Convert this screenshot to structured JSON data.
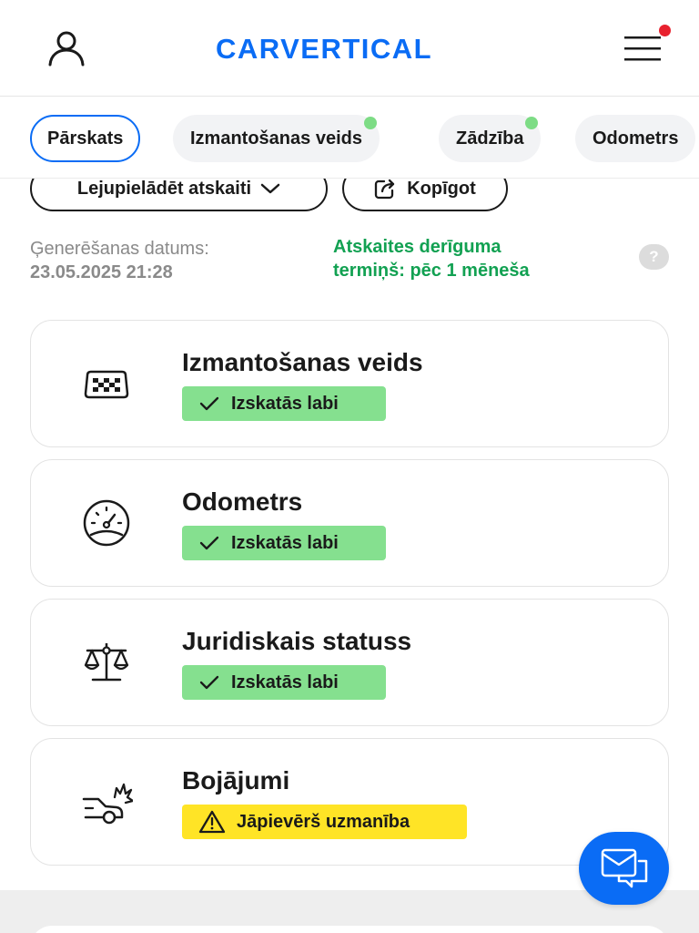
{
  "header": {
    "logo_text": "CARVERTICAL",
    "user_icon": "user-icon",
    "menu_icon": "hamburger-menu-icon",
    "menu_notification": true
  },
  "tabs": [
    {
      "label": "Pārskats",
      "active": true,
      "indicator": false
    },
    {
      "label": "Izmantošanas veids",
      "active": false,
      "indicator": true
    },
    {
      "label": "Zādzība",
      "active": false,
      "indicator": true
    },
    {
      "label": "Odometrs",
      "active": false,
      "indicator": false
    }
  ],
  "actions": {
    "download_label": "Lejupielādēt atskaiti",
    "share_label": "Kopīgot"
  },
  "meta": {
    "generated_label": "Ģenerēšanas datums:",
    "generated_date": "23.05.2025 21:28",
    "validity_line1": "Atskaites derīguma",
    "validity_line2": "termiņš: pēc 1 mēneša",
    "help_symbol": "?"
  },
  "cards": [
    {
      "title": "Izmantošanas veids",
      "icon": "taxi-sign-icon",
      "status": "Izskatās labi",
      "status_type": "good"
    },
    {
      "title": "Odometrs",
      "icon": "speedometer-icon",
      "status": "Izskatās labi",
      "status_type": "good"
    },
    {
      "title": "Juridiskais statuss",
      "icon": "scales-icon",
      "status": "Izskatās labi",
      "status_type": "good"
    },
    {
      "title": "Bojājumi",
      "icon": "car-crash-icon",
      "status": "Jāpievērš uzmanība",
      "status_type": "warning"
    }
  ],
  "colors": {
    "brand_blue": "#0a6cf5",
    "good_green": "#85e08f",
    "validity_green": "#12a152",
    "warning_yellow": "#ffe426",
    "notification_red": "#e8212e"
  },
  "chat_fab_icon": "chat-messages-icon"
}
